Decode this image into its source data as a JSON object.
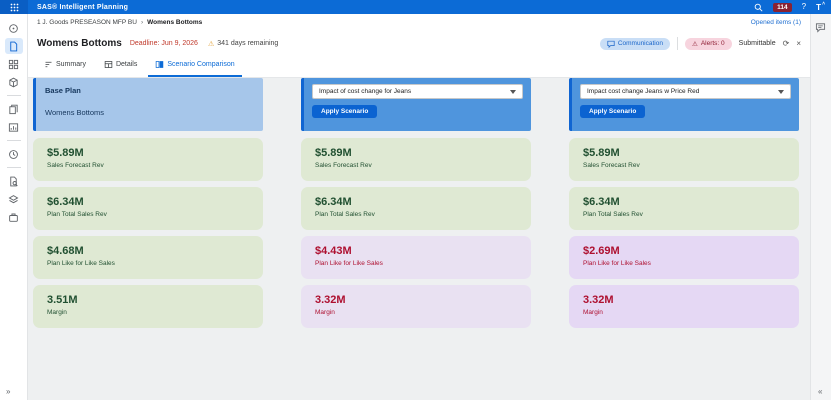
{
  "app": {
    "title": "SAS® Intelligent Planning",
    "notification_count": "114",
    "help_glyph": "?",
    "avatar_initial": "T"
  },
  "breadcrumb": {
    "parent": "1 J. Goods PRESEASON MFP BU",
    "separator": "›",
    "current": "Womens Bottoms",
    "opened_items": "Opened items (1)"
  },
  "header": {
    "title": "Womens Bottoms",
    "deadline": "Deadline: Jun 9, 2026",
    "warning_glyph": "⚠",
    "days_remaining": "341 days remaining",
    "communication": "Communication",
    "alerts": "Alerts: 0",
    "submittable": "Submittable",
    "refresh_glyph": "⟳",
    "close_glyph": "×"
  },
  "tabs": {
    "summary": "Summary",
    "details": "Details",
    "scenario_comparison": "Scenario Comparison"
  },
  "columns": {
    "base": {
      "title": "Base Plan",
      "subtitle": "Womens Bottoms",
      "metrics": [
        {
          "value": "$5.89M",
          "label": "Sales Forecast Rev"
        },
        {
          "value": "$6.34M",
          "label": "Plan Total Sales Rev"
        },
        {
          "value": "$4.68M",
          "label": "Plan Like for Like Sales"
        },
        {
          "value": "3.51M",
          "label": "Margin"
        }
      ]
    },
    "scenario1": {
      "dropdown_value": "Impact of cost change for Jeans",
      "apply_label": "Apply Scenario",
      "metrics": [
        {
          "value": "$5.89M",
          "label": "Sales Forecast Rev"
        },
        {
          "value": "$6.34M",
          "label": "Plan Total Sales Rev"
        },
        {
          "value": "$4.43M",
          "label": "Plan Like for Like Sales"
        },
        {
          "value": "3.32M",
          "label": "Margin"
        }
      ]
    },
    "scenario2": {
      "dropdown_value": "Impact cost change Jeans w Price Red",
      "apply_label": "Apply Scenario",
      "metrics": [
        {
          "value": "$5.89M",
          "label": "Sales Forecast Rev"
        },
        {
          "value": "$6.34M",
          "label": "Plan Total Sales Rev"
        },
        {
          "value": "$2.69M",
          "label": "Plan Like for Like Sales"
        },
        {
          "value": "3.32M",
          "label": "Margin"
        }
      ]
    }
  },
  "glyphs": {
    "sidebar_expand": "»",
    "rail_collapse": "«"
  },
  "colors": {
    "topbar": "#0c6bd6",
    "accent_blue": "#0b63d1",
    "base_header_bg": "#a6c6ea",
    "scenario_header_bg": "#4f95dd",
    "good_card_bg": "#dfe9d3",
    "good_text": "#215031",
    "bad_card_bg": "#e9e1f2",
    "bad_card_bg_alt": "#e5d8f4",
    "bad_text": "#ae1030",
    "notification_badge_bg": "#8a2232",
    "alerts_pill_bg": "#f7d4de",
    "communication_pill_bg": "#c9def6"
  }
}
